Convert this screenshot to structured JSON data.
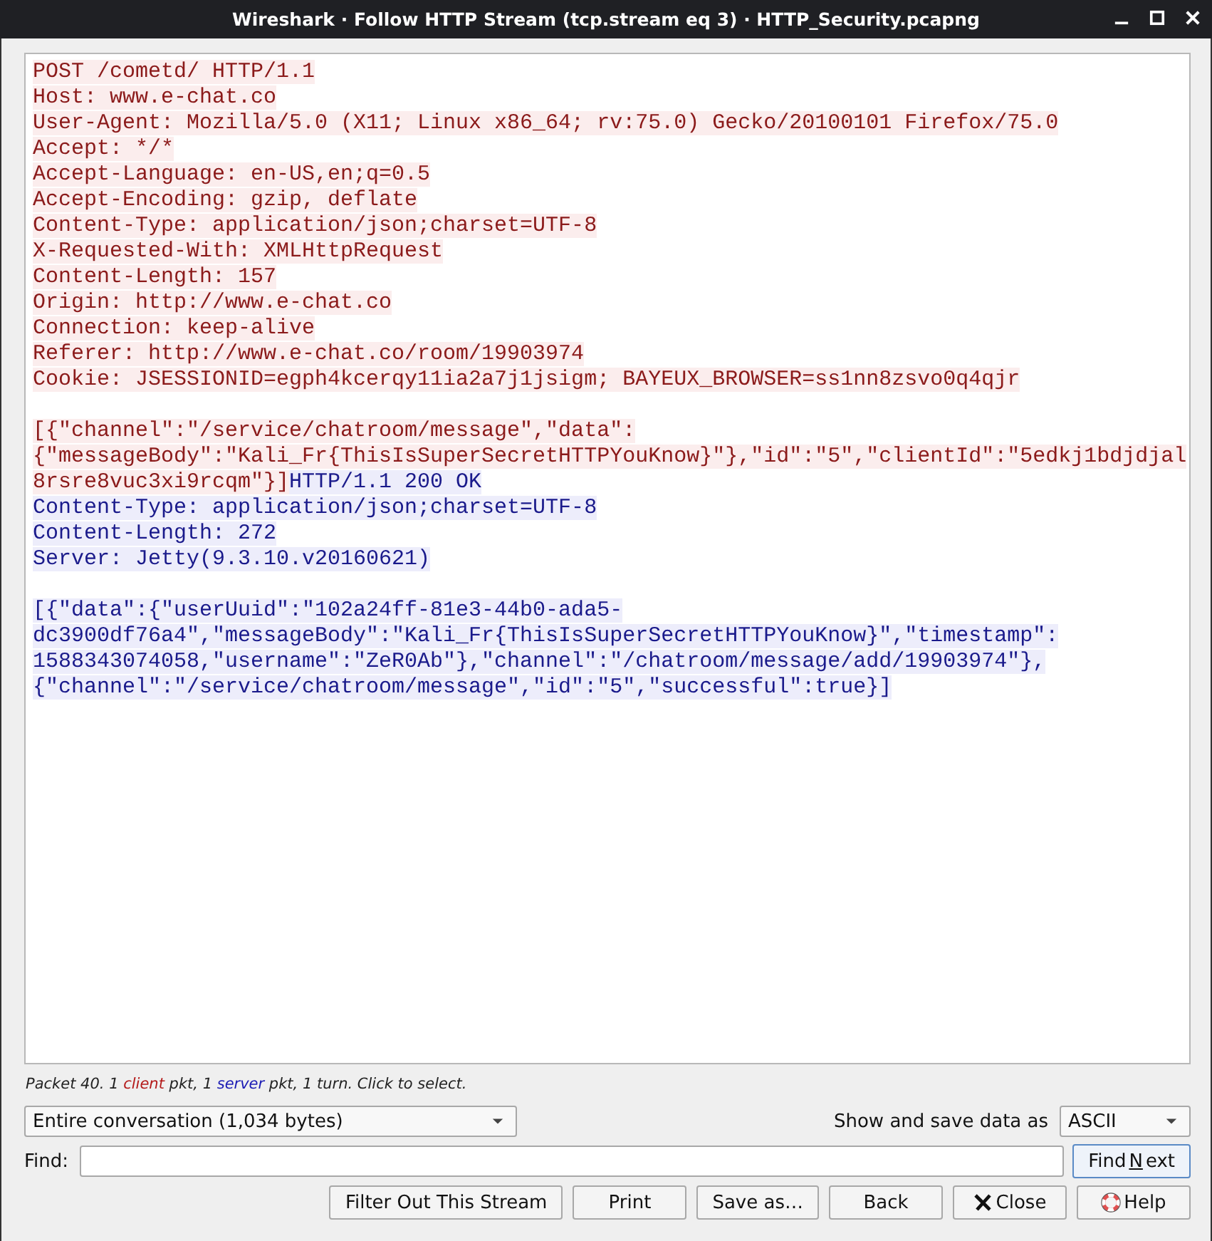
{
  "window": {
    "title": "Wireshark · Follow HTTP Stream (tcp.stream eq 3) · HTTP_Security.pcapng"
  },
  "stream_blocks": [
    [
      [
        {
          "kind": "client",
          "text": "POST /cometd/ HTTP/1.1"
        }
      ],
      [
        {
          "kind": "client",
          "text": "Host: www.e-chat.co"
        }
      ],
      [
        {
          "kind": "client",
          "text": "User-Agent: Mozilla/5.0 (X11; Linux x86_64; rv:75.0) Gecko/20100101 Firefox/75.0"
        }
      ],
      [
        {
          "kind": "client",
          "text": "Accept: */*"
        }
      ],
      [
        {
          "kind": "client",
          "text": "Accept-Language: en-US,en;q=0.5"
        }
      ],
      [
        {
          "kind": "client",
          "text": "Accept-Encoding: gzip, deflate"
        }
      ],
      [
        {
          "kind": "client",
          "text": "Content-Type: application/json;charset=UTF-8"
        }
      ],
      [
        {
          "kind": "client",
          "text": "X-Requested-With: XMLHttpRequest"
        }
      ],
      [
        {
          "kind": "client",
          "text": "Content-Length: 157"
        }
      ],
      [
        {
          "kind": "client",
          "text": "Origin: http://www.e-chat.co"
        }
      ],
      [
        {
          "kind": "client",
          "text": "Connection: keep-alive"
        }
      ],
      [
        {
          "kind": "client",
          "text": "Referer: http://www.e-chat.co/room/19903974"
        }
      ],
      [
        {
          "kind": "client",
          "text": "Cookie: JSESSIONID=egph4kcerqy11ia2a7j1jsigm; BAYEUX_BROWSER=ss1nn8zsvo0q4qjr"
        }
      ]
    ],
    [
      [
        {
          "kind": "client",
          "text": "[{\"channel\":\"/service/chatroom/message\",\"data\":"
        }
      ],
      [
        {
          "kind": "client",
          "text": "{\"messageBody\":\"Kali_Fr{ThisIsSuperSecretHTTPYouKnow}\"},\"id\":\"5\",\"clientId\":\"5edkj1bdjdjal"
        }
      ],
      [
        {
          "kind": "client",
          "text": "8rsre8vuc3xi9rcqm\"}]"
        },
        {
          "kind": "server",
          "text": "HTTP/1.1 200 OK"
        }
      ],
      [
        {
          "kind": "server",
          "text": "Content-Type: application/json;charset=UTF-8"
        }
      ],
      [
        {
          "kind": "server",
          "text": "Content-Length: 272"
        }
      ],
      [
        {
          "kind": "server",
          "text": "Server: Jetty(9.3.10.v20160621)"
        }
      ]
    ],
    [
      [
        {
          "kind": "server",
          "text": "[{\"data\":{\"userUuid\":\"102a24ff-81e3-44b0-ada5-"
        }
      ],
      [
        {
          "kind": "server",
          "text": "dc3900df76a4\",\"messageBody\":\"Kali_Fr{ThisIsSuperSecretHTTPYouKnow}\",\"timestamp\":"
        }
      ],
      [
        {
          "kind": "server",
          "text": "1588343074058,\"username\":\"ZeR0Ab\"},\"channel\":\"/chatroom/message/add/19903974\"},"
        }
      ],
      [
        {
          "kind": "server",
          "text": "{\"channel\":\"/service/chatroom/message\",\"id\":\"5\",\"successful\":true}]"
        }
      ]
    ]
  ],
  "status_text": [
    {
      "kind": "plain",
      "text": "Packet 40. 1 "
    },
    {
      "kind": "client",
      "text": "client"
    },
    {
      "kind": "plain",
      "text": " pkt, 1 "
    },
    {
      "kind": "server",
      "text": "server"
    },
    {
      "kind": "plain",
      "text": " pkt, 1 turn. Click to select."
    }
  ],
  "conversation_select": {
    "value": "Entire conversation (1,034 bytes)"
  },
  "show_as": {
    "label": "Show and save data as",
    "value": "ASCII"
  },
  "find": {
    "label": "Find:",
    "button": {
      "label_before": "Find ",
      "mnemonic": "N",
      "label_after": "ext",
      "focused": true
    }
  },
  "buttons": [
    {
      "label": "Filter Out This Stream",
      "kind": "plain"
    },
    {
      "label": "Print",
      "kind": "plain"
    },
    {
      "label": "Save as…",
      "kind": "plain"
    },
    {
      "label": "Back",
      "kind": "plain"
    },
    {
      "label": "Close",
      "kind": "close"
    },
    {
      "label": "Help",
      "kind": "help"
    }
  ]
}
